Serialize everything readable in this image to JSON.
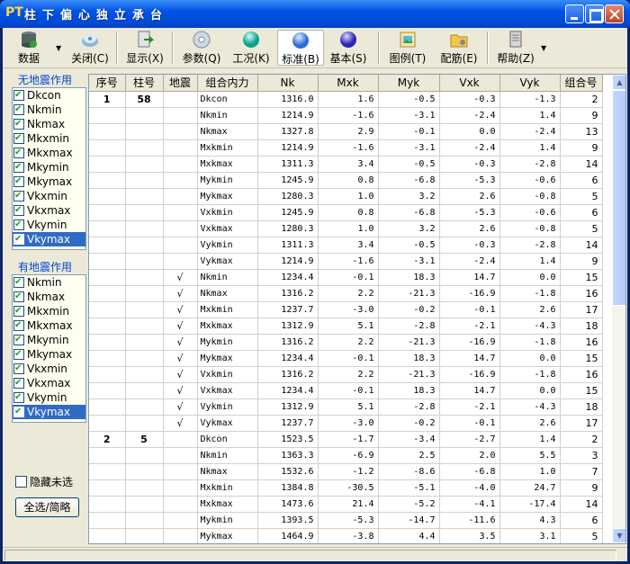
{
  "window": {
    "logo": "PT",
    "title": "柱下偏心独立承台"
  },
  "toolbar": [
    {
      "label": "数据",
      "icon": "database-icon",
      "dropdown": true
    },
    {
      "label": "关闭(C)",
      "icon": "close-disc-icon"
    },
    {
      "label": "显示(X)",
      "icon": "export-icon"
    },
    {
      "label": "参数(Q)",
      "icon": "disc-icon"
    },
    {
      "label": "工况(K)",
      "icon": "green-sphere-icon"
    },
    {
      "label": "标准(B)",
      "icon": "blue-sphere-icon",
      "active": true
    },
    {
      "label": "基本(S)",
      "icon": "purple-sphere-icon"
    },
    {
      "label": "图例(T)",
      "icon": "picture-icon"
    },
    {
      "label": "配筋(E)",
      "icon": "folder-gear-icon"
    },
    {
      "label": "帮助(Z)",
      "icon": "help-doc-icon",
      "dropdown": true
    }
  ],
  "left": {
    "group1": {
      "title": "无地震作用",
      "items": [
        "Dkcon",
        "Nkmin",
        "Nkmax",
        "Mkxmin",
        "Mkxmax",
        "Mkymin",
        "Mkymax",
        "Vkxmin",
        "Vkxmax",
        "Vkymin",
        "Vkymax"
      ],
      "selected": "Vkymax"
    },
    "group2": {
      "title": "有地震作用",
      "items": [
        "Nkmin",
        "Nkmax",
        "Mkxmin",
        "Mkxmax",
        "Mkymin",
        "Mkymax",
        "Vkxmin",
        "Vkxmax",
        "Vkymin",
        "Vkymax"
      ],
      "selected": "Vkymax"
    },
    "hide_label": "隐藏未选",
    "select_all": "全选/简略"
  },
  "table": {
    "columns": [
      "序号",
      "柱号",
      "地震",
      "组合内力",
      "Nk",
      "Mxk",
      "Myk",
      "Vxk",
      "Vyk",
      "组合号"
    ],
    "rows": [
      [
        "1",
        "58",
        "",
        "Dkcon",
        "1316.0",
        "1.6",
        "-0.5",
        "-0.3",
        "-1.3",
        "2"
      ],
      [
        "",
        "",
        "",
        "Nkmin",
        "1214.9",
        "-1.6",
        "-3.1",
        "-2.4",
        "1.4",
        "9"
      ],
      [
        "",
        "",
        "",
        "Nkmax",
        "1327.8",
        "2.9",
        "-0.1",
        "0.0",
        "-2.4",
        "13"
      ],
      [
        "",
        "",
        "",
        "Mxkmin",
        "1214.9",
        "-1.6",
        "-3.1",
        "-2.4",
        "1.4",
        "9"
      ],
      [
        "",
        "",
        "",
        "Mxkmax",
        "1311.3",
        "3.4",
        "-0.5",
        "-0.3",
        "-2.8",
        "14"
      ],
      [
        "",
        "",
        "",
        "Mykmin",
        "1245.9",
        "0.8",
        "-6.8",
        "-5.3",
        "-0.6",
        "6"
      ],
      [
        "",
        "",
        "",
        "Mykmax",
        "1280.3",
        "1.0",
        "3.2",
        "2.6",
        "-0.8",
        "5"
      ],
      [
        "",
        "",
        "",
        "Vxkmin",
        "1245.9",
        "0.8",
        "-6.8",
        "-5.3",
        "-0.6",
        "6"
      ],
      [
        "",
        "",
        "",
        "Vxkmax",
        "1280.3",
        "1.0",
        "3.2",
        "2.6",
        "-0.8",
        "5"
      ],
      [
        "",
        "",
        "",
        "Vykmin",
        "1311.3",
        "3.4",
        "-0.5",
        "-0.3",
        "-2.8",
        "14"
      ],
      [
        "",
        "",
        "",
        "Vykmax",
        "1214.9",
        "-1.6",
        "-3.1",
        "-2.4",
        "1.4",
        "9"
      ],
      [
        "",
        "",
        "√",
        "Nkmin",
        "1234.4",
        "-0.1",
        "18.3",
        "14.7",
        "0.0",
        "15"
      ],
      [
        "",
        "",
        "√",
        "Nkmax",
        "1316.2",
        "2.2",
        "-21.3",
        "-16.9",
        "-1.8",
        "16"
      ],
      [
        "",
        "",
        "√",
        "Mxkmin",
        "1237.7",
        "-3.0",
        "-0.2",
        "-0.1",
        "2.6",
        "17"
      ],
      [
        "",
        "",
        "√",
        "Mxkmax",
        "1312.9",
        "5.1",
        "-2.8",
        "-2.1",
        "-4.3",
        "18"
      ],
      [
        "",
        "",
        "√",
        "Mykmin",
        "1316.2",
        "2.2",
        "-21.3",
        "-16.9",
        "-1.8",
        "16"
      ],
      [
        "",
        "",
        "√",
        "Mykmax",
        "1234.4",
        "-0.1",
        "18.3",
        "14.7",
        "0.0",
        "15"
      ],
      [
        "",
        "",
        "√",
        "Vxkmin",
        "1316.2",
        "2.2",
        "-21.3",
        "-16.9",
        "-1.8",
        "16"
      ],
      [
        "",
        "",
        "√",
        "Vxkmax",
        "1234.4",
        "-0.1",
        "18.3",
        "14.7",
        "0.0",
        "15"
      ],
      [
        "",
        "",
        "√",
        "Vykmin",
        "1312.9",
        "5.1",
        "-2.8",
        "-2.1",
        "-4.3",
        "18"
      ],
      [
        "",
        "",
        "√",
        "Vykmax",
        "1237.7",
        "-3.0",
        "-0.2",
        "-0.1",
        "2.6",
        "17"
      ],
      [
        "2",
        "5",
        "",
        "Dkcon",
        "1523.5",
        "-1.7",
        "-3.4",
        "-2.7",
        "1.4",
        "2"
      ],
      [
        "",
        "",
        "",
        "Nkmin",
        "1363.3",
        "-6.9",
        "2.5",
        "2.0",
        "5.5",
        "3"
      ],
      [
        "",
        "",
        "",
        "Nkmax",
        "1532.6",
        "-1.2",
        "-8.6",
        "-6.8",
        "1.0",
        "7"
      ],
      [
        "",
        "",
        "",
        "Mxkmin",
        "1384.8",
        "-30.5",
        "-5.1",
        "-4.0",
        "24.7",
        "9"
      ],
      [
        "",
        "",
        "",
        "Mxkmax",
        "1473.6",
        "21.4",
        "-5.2",
        "-4.1",
        "-17.4",
        "14"
      ],
      [
        "",
        "",
        "",
        "Mykmin",
        "1393.5",
        "-5.3",
        "-14.7",
        "-11.6",
        "4.3",
        "6"
      ],
      [
        "",
        "",
        "",
        "Mykmax",
        "1464.9",
        "-3.8",
        "4.4",
        "3.5",
        "3.1",
        "5"
      ]
    ]
  }
}
